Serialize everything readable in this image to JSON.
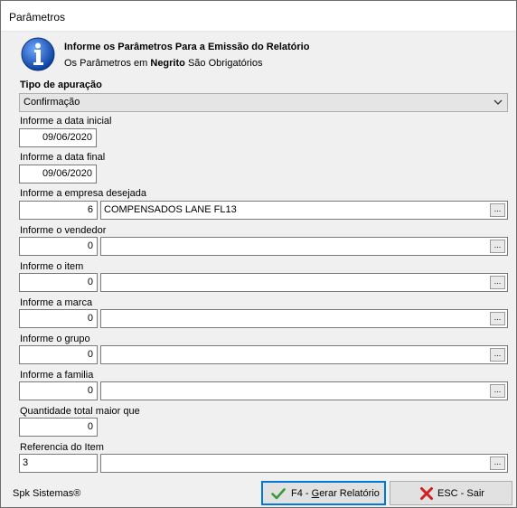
{
  "window": {
    "title": "Parâmetros"
  },
  "header": {
    "title": "Informe os Parâmetros Para a Emissão do Relatório",
    "sub_prefix": "Os Parâmetros em",
    "sub_bold": "Negrito",
    "sub_suffix": "São Obrigatórios"
  },
  "tipo": {
    "label": "Tipo de apuração",
    "value": "Confirmação"
  },
  "data_inicial": {
    "label": "Informe a data inicial",
    "value": "09/06/2020"
  },
  "data_final": {
    "label": "Informe a data final",
    "value": "09/06/2020"
  },
  "empresa": {
    "label": "Informe a empresa desejada",
    "code": "6",
    "desc": "COMPENSADOS LANE FL13"
  },
  "vendedor": {
    "label": "Informe o vendedor",
    "code": "0",
    "desc": ""
  },
  "item": {
    "label": "Informe o item",
    "code": "0",
    "desc": ""
  },
  "marca": {
    "label": "Informe a marca",
    "code": "0",
    "desc": ""
  },
  "grupo": {
    "label": "Informe o grupo",
    "code": "0",
    "desc": ""
  },
  "familia": {
    "label": "Informe a familia",
    "code": "0",
    "desc": ""
  },
  "quantidade": {
    "label": "Quantidade total maior que",
    "value": "0"
  },
  "referencia": {
    "label": "Referencia do Item",
    "code": "3",
    "desc": ""
  },
  "ellipsis": "...",
  "footer": {
    "brand": "Spk Sistemas®",
    "gerar_prefix": "F4 - ",
    "gerar_underline": "G",
    "gerar_suffix": "erar Relatório",
    "sair_label": "ESC - Sair"
  },
  "icons": {
    "info": "info-icon",
    "dropdown": "chevron-down-icon",
    "gerar": "checkmark-icon",
    "sair": "red-x-icon"
  },
  "colors": {
    "info_blue": "#1a5fb4",
    "check_green": "#3a9a3a",
    "close_red": "#d21f1f",
    "focus_border": "#0078d7"
  }
}
